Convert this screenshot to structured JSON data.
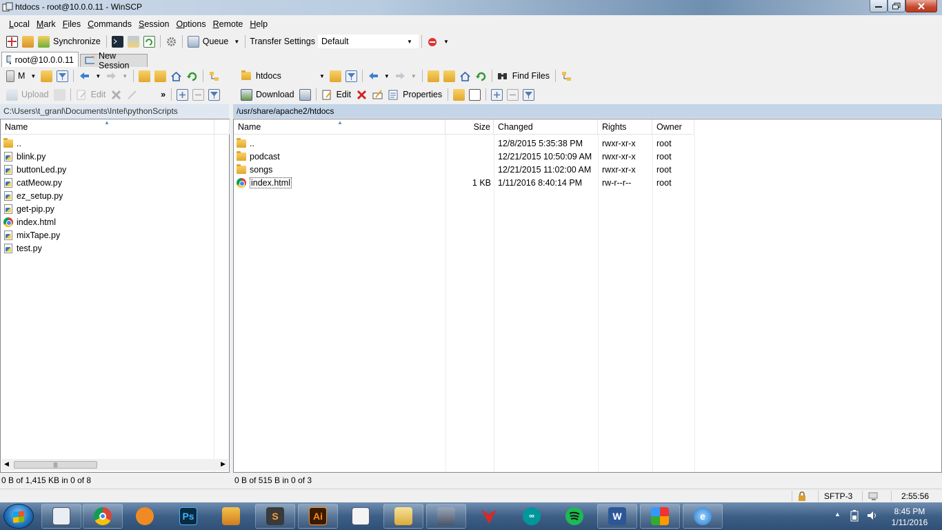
{
  "window": {
    "title": "htdocs - root@10.0.0.11 - WinSCP"
  },
  "menu": [
    "Local",
    "Mark",
    "Files",
    "Commands",
    "Session",
    "Options",
    "Remote",
    "Help"
  ],
  "toolbar": {
    "synchronize_label": "Synchronize",
    "queue_label": "Queue",
    "transfer_settings_label": "Transfer Settings",
    "transfer_settings_value": "Default"
  },
  "tabs": [
    {
      "label": "root@10.0.0.11",
      "active": true
    },
    {
      "label": "New Session",
      "active": false
    }
  ],
  "left_panel": {
    "drive_label": "M",
    "upload_label": "Upload",
    "edit_label": "Edit",
    "overflow_label": "»",
    "path": "C:\\Users\\t_granl\\Documents\\Intel\\pythonScripts",
    "columns": [
      "Name"
    ],
    "files": [
      {
        "name": "..",
        "icon": "parent-folder-icon"
      },
      {
        "name": "blink.py",
        "icon": "python-file-icon"
      },
      {
        "name": "buttonLed.py",
        "icon": "python-file-icon"
      },
      {
        "name": "catMeow.py",
        "icon": "python-file-icon"
      },
      {
        "name": "ez_setup.py",
        "icon": "python-file-icon"
      },
      {
        "name": "get-pip.py",
        "icon": "python-file-icon"
      },
      {
        "name": "index.html",
        "icon": "chrome-file-icon"
      },
      {
        "name": "mixTape.py",
        "icon": "python-file-icon"
      },
      {
        "name": "test.py",
        "icon": "python-file-icon"
      }
    ],
    "summary": "0 B of 1,415 KB in 0 of 8"
  },
  "right_panel": {
    "dir_label": "htdocs",
    "find_files_label": "Find Files",
    "download_label": "Download",
    "edit_label": "Edit",
    "properties_label": "Properties",
    "path": "/usr/share/apache2/htdocs",
    "columns": {
      "name": "Name",
      "size": "Size",
      "changed": "Changed",
      "rights": "Rights",
      "owner": "Owner"
    },
    "files": [
      {
        "name": "..",
        "size": "",
        "changed": "12/8/2015 5:35:38 PM",
        "rights": "rwxr-xr-x",
        "owner": "root",
        "icon": "parent-folder-icon"
      },
      {
        "name": "podcast",
        "size": "",
        "changed": "12/21/2015 10:50:09 AM",
        "rights": "rwxr-xr-x",
        "owner": "root",
        "icon": "folder-icon"
      },
      {
        "name": "songs",
        "size": "",
        "changed": "12/21/2015 11:02:00 AM",
        "rights": "rwxr-xr-x",
        "owner": "root",
        "icon": "folder-icon"
      },
      {
        "name": "index.html",
        "size": "1 KB",
        "changed": "1/11/2016 8:40:14 PM",
        "rights": "rw-r--r--",
        "owner": "root",
        "icon": "chrome-file-icon"
      }
    ],
    "summary": "0 B of 515 B in 0 of 3"
  },
  "status": {
    "protocol": "SFTP-3",
    "elapsed": "2:55:56"
  },
  "taskbar": {
    "apps": [
      "winscp",
      "chrome",
      "vlc-capture",
      "photoshop",
      "folder-app",
      "sublime-text",
      "illustrator",
      "document-viewer",
      "file-explorer",
      "network-tool",
      "vector-app",
      "arduino",
      "spotify",
      "word",
      "avg",
      "internet-explorer"
    ],
    "clock_time": "8:45 PM",
    "clock_date": "1/11/2016"
  },
  "colors": {
    "title_gradient_end": "#6f8fb0",
    "path_active": "#c4d5e8",
    "accent": "#1c6fb8"
  }
}
